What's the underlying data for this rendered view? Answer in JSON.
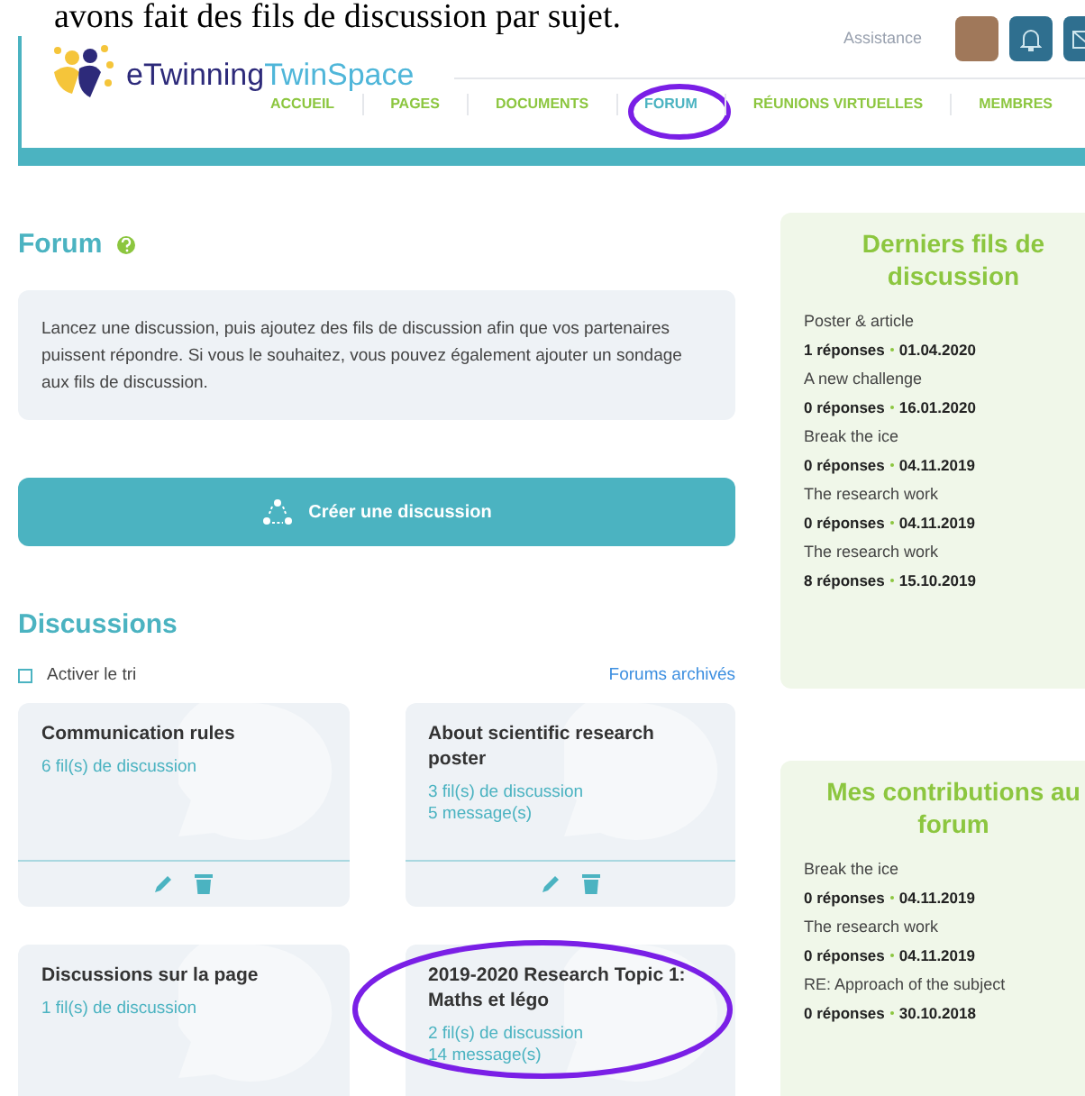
{
  "caption": "avons fait des fils de discussion par sujet.",
  "header": {
    "logo_text_1": "eTwinning",
    "logo_text_2": "TwinSpace",
    "assistance": "Assistance"
  },
  "nav": [
    {
      "label": "ACCUEIL",
      "selected": false
    },
    {
      "label": "PAGES",
      "selected": false
    },
    {
      "label": "DOCUMENTS",
      "selected": false
    },
    {
      "label": "FORUM",
      "selected": true
    },
    {
      "label": "RÉUNIONS VIRTUELLES",
      "selected": false
    },
    {
      "label": "MEMBRES",
      "selected": false
    }
  ],
  "forum": {
    "title": "Forum",
    "info": "Lancez une discussion, puis ajoutez des fils de discussion afin que vos partenaires puissent répondre. Si vous le souhaitez, vous pouvez également ajouter un sondage aux fils de discussion.",
    "create_button": "Créer une discussion"
  },
  "discussions": {
    "title": "Discussions",
    "sort_label": "Activer le tri",
    "sort_checked": false,
    "archived_link": "Forums archivés",
    "cards": [
      {
        "title": "Communication rules",
        "stats": [
          "6 fil(s) de discussion"
        ],
        "editable": true
      },
      {
        "title": "About scientific research poster",
        "stats": [
          "3 fil(s) de discussion",
          "5 message(s)"
        ],
        "editable": true
      },
      {
        "title": "Discussions sur la page",
        "stats": [
          "1 fil(s) de discussion"
        ]
      },
      {
        "title": "2019-2020 Research Topic 1: Maths et légo",
        "stats": [
          "2 fil(s) de discussion",
          "14 message(s)"
        ]
      }
    ]
  },
  "sidebar": [
    {
      "title": "Derniers fils de discussion",
      "items": [
        {
          "name": "Poster & article",
          "replies": "1 réponses",
          "date": "01.04.2020"
        },
        {
          "name": "A new challenge",
          "replies": "0 réponses",
          "date": "16.01.2020"
        },
        {
          "name": "Break the ice",
          "replies": "0 réponses",
          "date": "04.11.2019"
        },
        {
          "name": "The research work",
          "replies": "0 réponses",
          "date": "04.11.2019"
        },
        {
          "name": "The research work",
          "replies": "8 réponses",
          "date": "15.10.2019"
        }
      ]
    },
    {
      "title": "Mes contributions au forum",
      "items": [
        {
          "name": "Break the ice",
          "replies": "0 réponses",
          "date": "04.11.2019"
        },
        {
          "name": "The research work",
          "replies": "0 réponses",
          "date": "04.11.2019"
        },
        {
          "name": "RE: Approach of the subject",
          "replies": "0 réponses",
          "date": "30.10.2018"
        }
      ]
    }
  ]
}
